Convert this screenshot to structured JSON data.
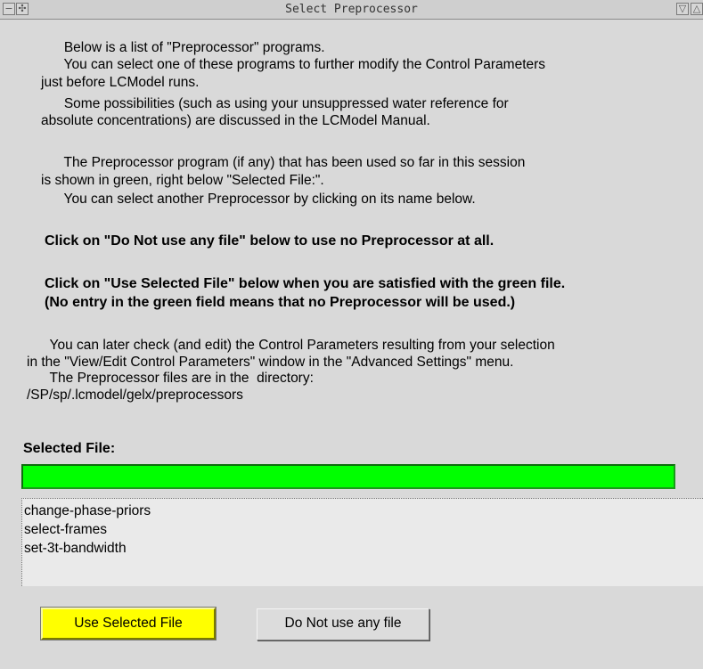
{
  "window": {
    "title": "Select Preprocessor",
    "menu_icon": "minus-icon",
    "move_icon": "move-icon",
    "minimize_icon": "triangle-down-icon",
    "maximize_icon": "triangle-up-icon"
  },
  "instructions": {
    "p1": [
      "      Below is a list of \"Preprocessor\" programs.",
      "      You can select one of these programs to further modify the Control Parameters",
      "just before LCModel runs.",
      "      Some possibilities (such as using your unsuppressed water reference for",
      "absolute concentrations) are discussed in the LCModel Manual."
    ],
    "p2": [
      "      The Preprocessor program (if any) that has been used so far in this session",
      "is shown in green, right below \"Selected File:\".",
      "      You can select another Preprocessor by clicking on its name below."
    ],
    "bold1": "Click on \"Do Not use any file\" below to use no Preprocessor at all.",
    "bold2": [
      "Click on \"Use Selected File\" below when you are satisfied with the green file.",
      "(No entry in the green field means that no Preprocessor will be used.)"
    ],
    "p3": [
      "      You can later check (and edit) the Control Parameters resulting from your selection",
      "in the \"View/Edit Control Parameters\" window in the \"Advanced Settings\" menu.",
      "      The Preprocessor files are in the  directory:",
      "/SP/sp/.lcmodel/gelx/preprocessors"
    ]
  },
  "selected_file": {
    "label": "Selected File:",
    "value": "",
    "color": "#00ff00"
  },
  "files": [
    "change-phase-priors",
    "select-frames",
    "set-3t-bandwidth"
  ],
  "buttons": {
    "use_selected": "Use Selected File",
    "use_selected_color": "#ffff00",
    "do_not_use": "Do Not use any file"
  }
}
